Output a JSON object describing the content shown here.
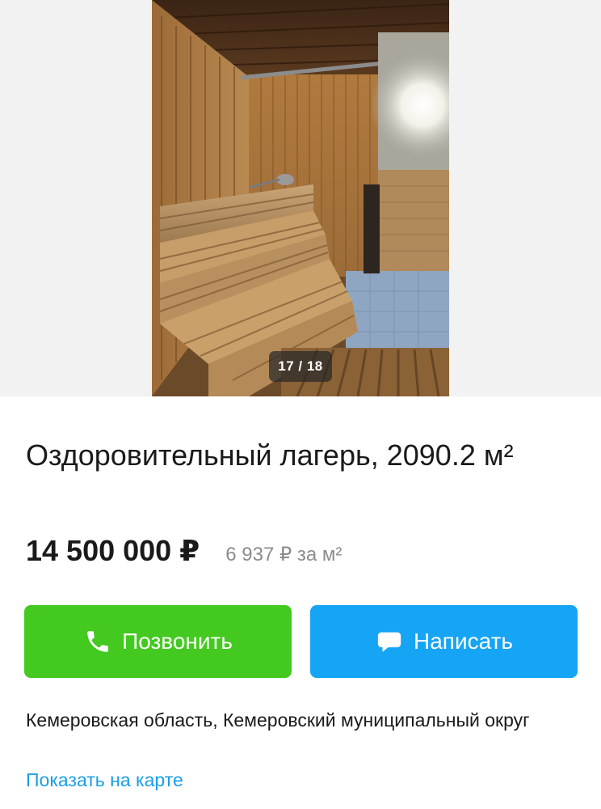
{
  "gallery": {
    "counter": "17 / 18",
    "current_index": 17,
    "total": 18
  },
  "listing": {
    "title": "Оздоровительный лагерь, 2090.2 м²",
    "price": "14 500 000 ₽",
    "price_per_m2": "6 937 ₽ за м²"
  },
  "actions": {
    "call_label": "Позвонить",
    "call_icon": "phone-icon",
    "write_label": "Написать",
    "write_icon": "chat-icon",
    "call_color": "#43c91f",
    "write_color": "#16a4f5"
  },
  "location": {
    "address": "Кемеровская область, Кемеровский муниципальный округ",
    "map_link": "Показать на карте",
    "link_color": "#1a9ee8"
  }
}
